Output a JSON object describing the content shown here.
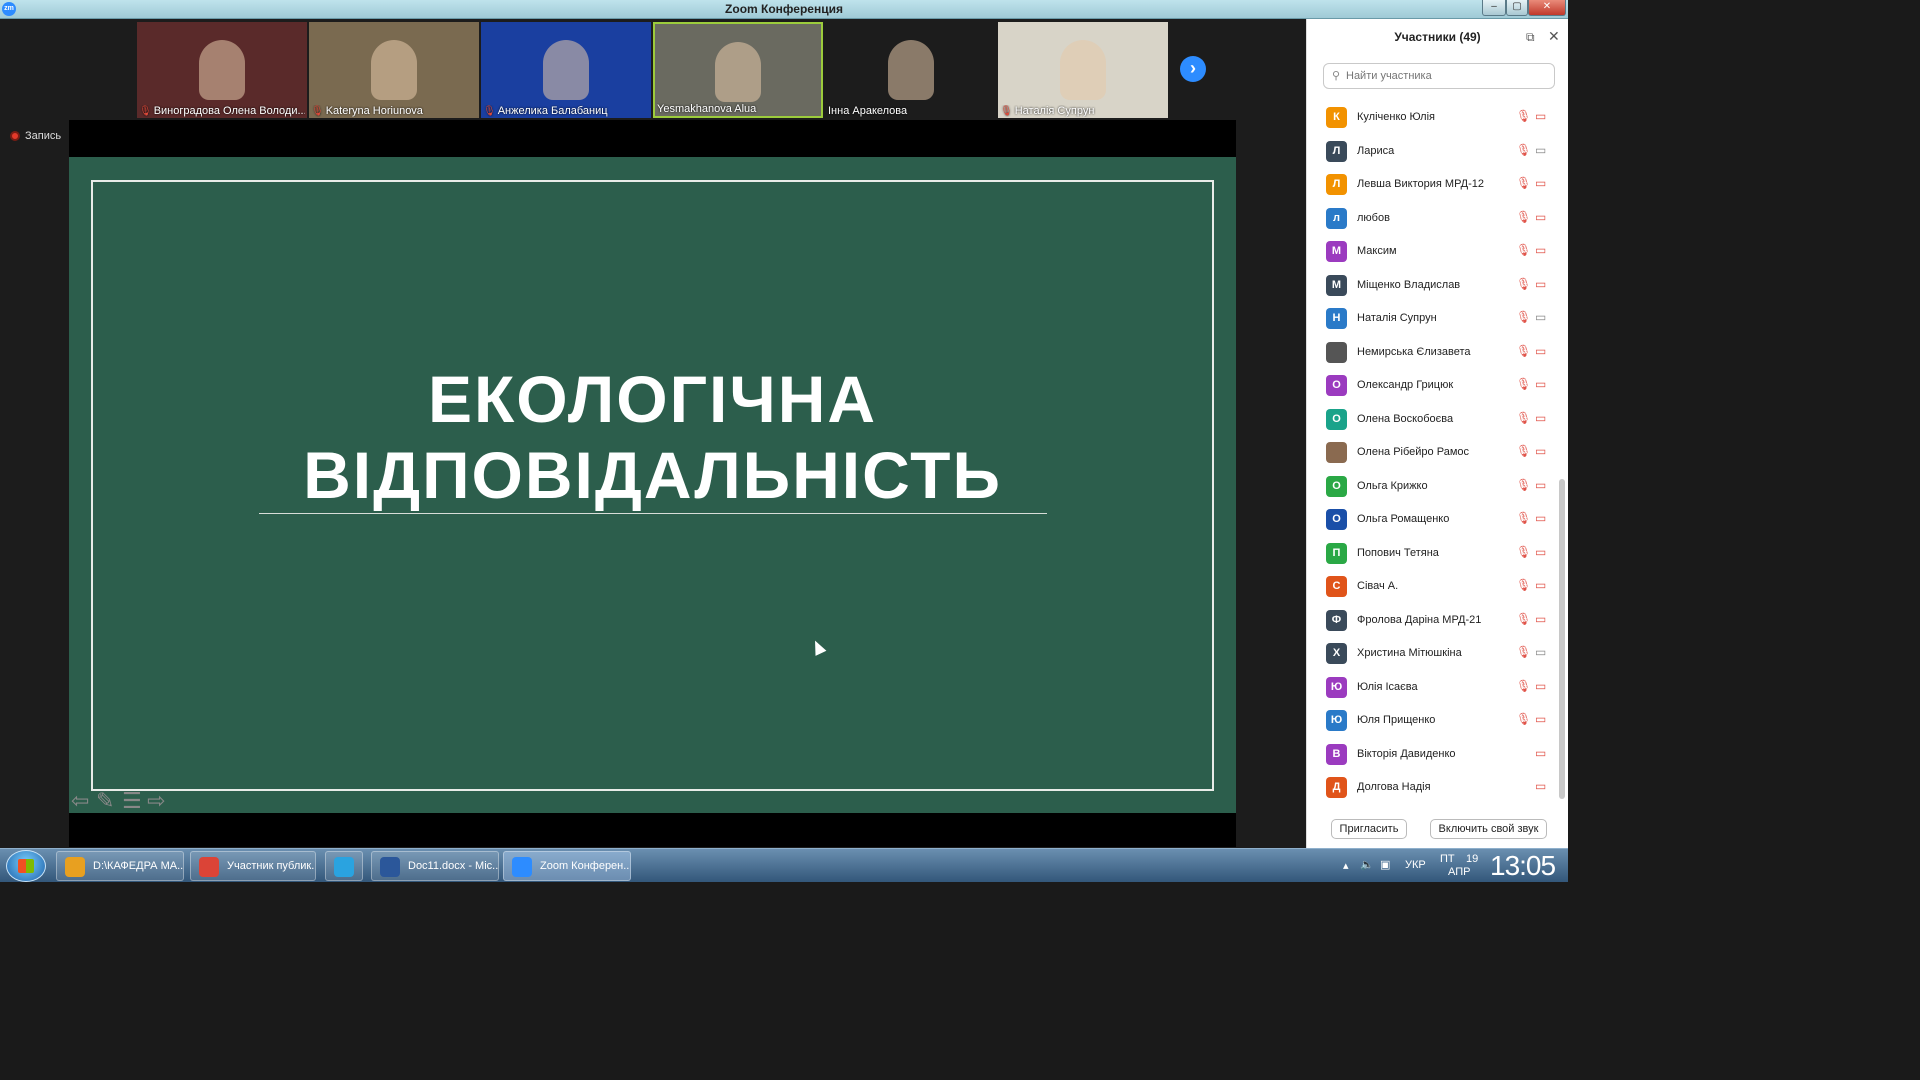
{
  "window": {
    "title": "Zoom Конференция",
    "controls": [
      "–",
      "▢",
      "✕"
    ]
  },
  "gallery": {
    "tiles": [
      {
        "name": "Виноградова Олена Володи...",
        "muted": true,
        "bg": "#5a2a2a"
      },
      {
        "name": "Kateryna Horiunova",
        "muted": true,
        "bg": "#7a6a50"
      },
      {
        "name": "Анжелика Балабаниц",
        "muted": true,
        "bg": "#1a3fa0"
      },
      {
        "name": "Yesmakhanova Alua",
        "muted": false,
        "bg": "#6a6a60",
        "active": true
      },
      {
        "name": "Інна Аракелова",
        "muted": false,
        "bg": "#1c1c1c"
      },
      {
        "name": "Наталія Супрун",
        "muted": true,
        "bg": "#d8d4c8"
      }
    ],
    "next_icon": "chevron-right-icon"
  },
  "recording": {
    "label": "Запись"
  },
  "slide": {
    "line1": "ЕКОЛОГІЧНА",
    "line2": "ВІДПОВІДАЛЬНІСТЬ"
  },
  "participants": {
    "header": "Участники (49)",
    "search_placeholder": "Найти участника",
    "list": [
      {
        "initial": "К",
        "name": "Куліченко Юлія",
        "color": "#f29200",
        "muted": true,
        "video": false
      },
      {
        "initial": "Л",
        "name": "Лариса",
        "color": "#3a4a5a",
        "muted": true,
        "video": true
      },
      {
        "initial": "Л",
        "name": "Левша Виктория МРД-12",
        "color": "#f29200",
        "muted": true,
        "video": false
      },
      {
        "initial": "л",
        "name": "любов",
        "color": "#2a7ac8",
        "muted": true,
        "video": false
      },
      {
        "initial": "М",
        "name": "Максим",
        "color": "#9b3bbf",
        "muted": true,
        "video": false
      },
      {
        "initial": "М",
        "name": "Міщенко Владислав",
        "color": "#3a4a5a",
        "muted": true,
        "video": false
      },
      {
        "initial": "Н",
        "name": "Наталія Супрун",
        "color": "#2a7ac8",
        "muted": true,
        "video": true
      },
      {
        "initial": "",
        "name": "Немирська Єлизавета",
        "color": "#555555",
        "muted": true,
        "video": false,
        "photo": true
      },
      {
        "initial": "О",
        "name": "Олександр Грицюк",
        "color": "#9b3bbf",
        "muted": true,
        "video": false
      },
      {
        "initial": "О",
        "name": "Олена Воскобоєва",
        "color": "#1aa38a",
        "muted": true,
        "video": false
      },
      {
        "initial": "",
        "name": "Олена Рібейро Рамос",
        "color": "#8a6a50",
        "muted": true,
        "video": false,
        "photo": true
      },
      {
        "initial": "О",
        "name": "Ольга Крижко",
        "color": "#2aa845",
        "muted": true,
        "video": false
      },
      {
        "initial": "О",
        "name": "Ольга Ромащенко",
        "color": "#1a4fa8",
        "muted": true,
        "video": false
      },
      {
        "initial": "П",
        "name": "Попович Тетяна",
        "color": "#2aa845",
        "muted": true,
        "video": false
      },
      {
        "initial": "С",
        "name": "Сівач А.",
        "color": "#e0541a",
        "muted": true,
        "video": false
      },
      {
        "initial": "Ф",
        "name": "Фролова Даріна МРД-21",
        "color": "#3a4a5a",
        "muted": true,
        "video": false
      },
      {
        "initial": "Х",
        "name": "Христина Мітюшкіна",
        "color": "#3a4a5a",
        "muted": true,
        "video": true
      },
      {
        "initial": "Ю",
        "name": "Юлія Ісаєва",
        "color": "#9b3bbf",
        "muted": true,
        "video": false
      },
      {
        "initial": "Ю",
        "name": "Юля Прищенко",
        "color": "#2a7ac8",
        "muted": true,
        "video": false
      },
      {
        "initial": "В",
        "name": "Вікторія Давиденко",
        "color": "#9b3bbf",
        "muted": false,
        "video": false
      },
      {
        "initial": "Д",
        "name": "Долгова Надія",
        "color": "#e0541a",
        "muted": false,
        "video": false
      }
    ],
    "invite_label": "Пригласить",
    "unmute_label": "Включить свой звук"
  },
  "taskbar": {
    "items": [
      {
        "label": "D:\\КАФЕДРА МА...",
        "icon_color": "#e8a020",
        "icon": "folder-icon"
      },
      {
        "label": "Участник публик...",
        "icon_color": "#db4437",
        "icon": "chrome-icon"
      },
      {
        "label": "",
        "icon_color": "#2aa3e0",
        "icon": "telegram-icon"
      },
      {
        "label": "Doc11.docx - Mic...",
        "icon_color": "#2b579a",
        "icon": "word-icon"
      },
      {
        "label": "Zoom Конферен...",
        "icon_color": "#2d8cff",
        "icon": "zoom-icon",
        "active": true
      }
    ],
    "lang": "УКР",
    "day": "ПТ",
    "date_num": "19",
    "month": "АПР",
    "time": "13:05"
  }
}
